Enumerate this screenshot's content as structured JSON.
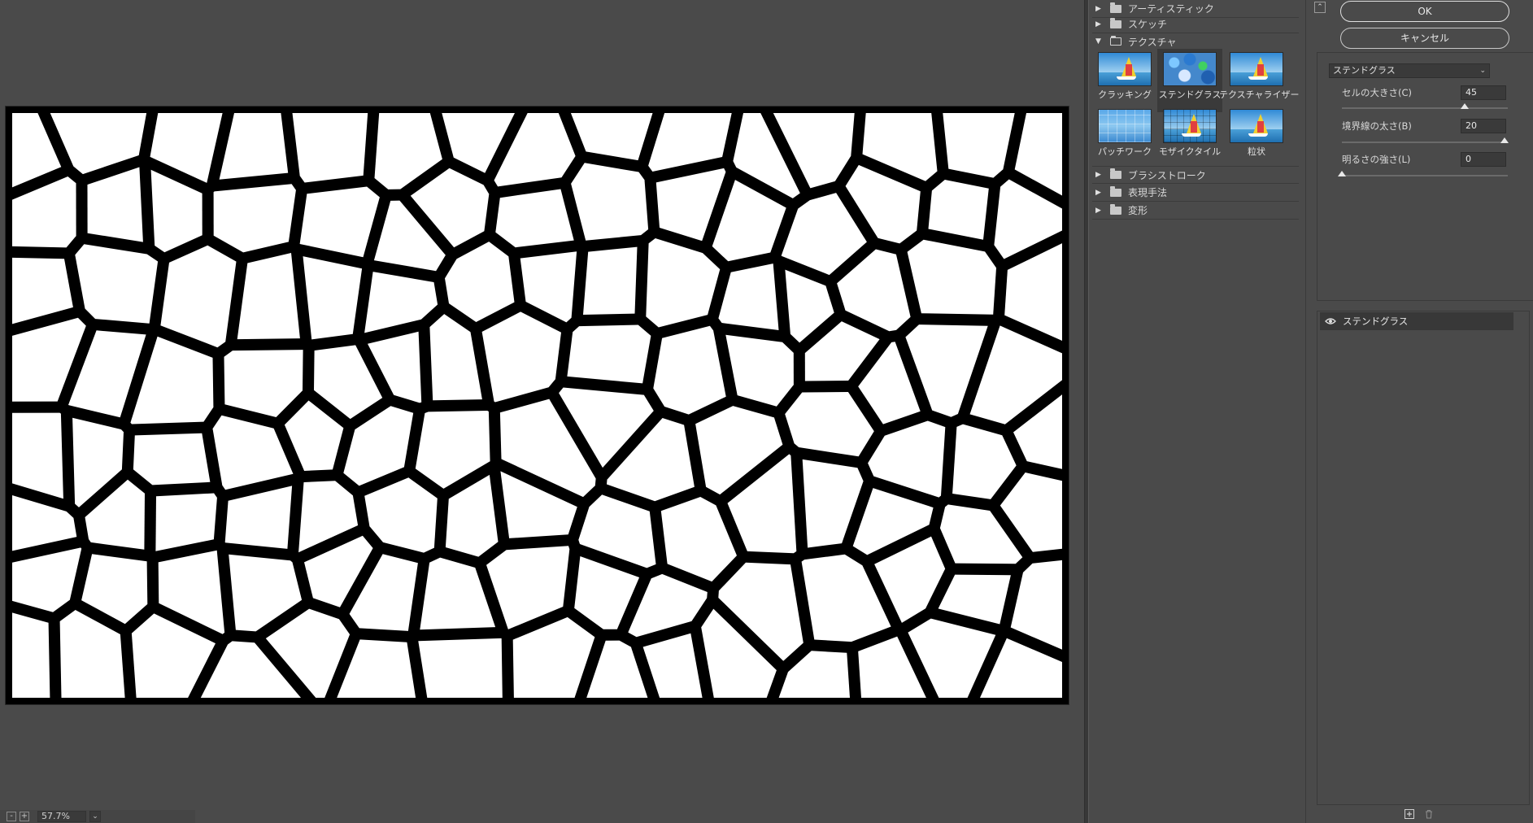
{
  "preview": {
    "zoom_value": "57.7%",
    "zoom_out_label": "-",
    "zoom_in_label": "+"
  },
  "gallery": {
    "folders_top": [
      {
        "label": "アーティスティック"
      },
      {
        "label": "スケッチ"
      }
    ],
    "open_folder": {
      "label": "テクスチャ"
    },
    "thumbnails": [
      {
        "label": "クラッキング",
        "style": "sky"
      },
      {
        "label": "ステンドグラス",
        "style": "stained",
        "selected": true
      },
      {
        "label": "テクスチャライザー",
        "style": "sky"
      },
      {
        "label": "パッチワーク",
        "style": "patch"
      },
      {
        "label": "モザイクタイル",
        "style": "mosaic"
      },
      {
        "label": "粒状",
        "style": "sky"
      }
    ],
    "folders_bottom": [
      {
        "label": "ブラシストローク"
      },
      {
        "label": "表現手法"
      },
      {
        "label": "変形"
      }
    ]
  },
  "settings": {
    "collapse_icon": "collapse-up-icon",
    "ok_label": "OK",
    "cancel_label": "キャンセル",
    "filter_selected": "ステンドグラス",
    "params": [
      {
        "label": "セルの大きさ(C)",
        "value": "45",
        "fraction": 0.74
      },
      {
        "label": "境界線の太さ(B)",
        "value": "20",
        "fraction": 0.98
      },
      {
        "label": "明るさの強さ(L)",
        "value": "0",
        "fraction": 0.0
      }
    ],
    "layer": {
      "name": "ステンドグラス",
      "icon": "eye-icon"
    },
    "footer_icons": [
      "new-layer-icon",
      "trash-icon"
    ]
  },
  "colors": {
    "panel_bg": "#4a4a4a",
    "dark_field": "#3a3a3a",
    "cell_fill": "#ffffff",
    "border_color": "#000000"
  }
}
